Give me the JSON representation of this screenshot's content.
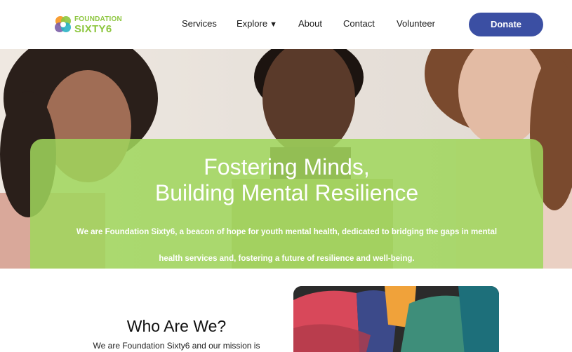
{
  "brand": {
    "line1": "FOUNDATION",
    "line2": "SIXTY6",
    "colors": {
      "green": "#8dc63f",
      "blue": "#3b4fa3",
      "orange": "#f7941d",
      "purple": "#7b5ea7",
      "teal": "#2ab3c4"
    }
  },
  "nav": {
    "items": [
      {
        "label": "Services"
      },
      {
        "label": "Explore",
        "caret": "▼"
      },
      {
        "label": "About"
      },
      {
        "label": "Contact"
      },
      {
        "label": "Volunteer"
      }
    ],
    "donate_label": "Donate"
  },
  "hero": {
    "title_line1": "Fostering Minds,",
    "title_line2": "Building Mental Resilience",
    "subtitle_line1": "We are Foundation Sixty6, a beacon of hope for youth mental health, dedicated to bridging the gaps in mental",
    "subtitle_line2": "health services and, fostering a future of resilience and well-being.",
    "card_color": "#a0d65c"
  },
  "about": {
    "title": "Who Are We?",
    "text": "We are Foundation Sixty6 and our mission is"
  }
}
